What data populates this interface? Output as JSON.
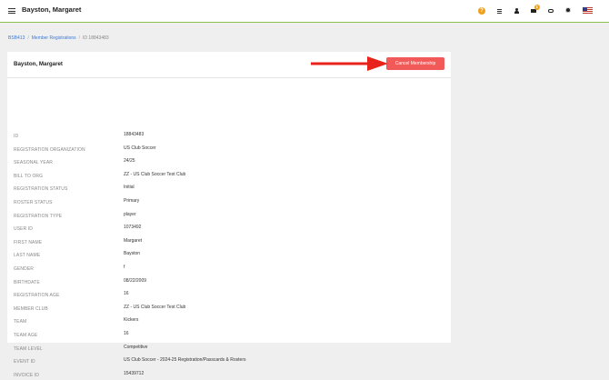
{
  "header": {
    "title": "Bayston, Margaret",
    "help_label": "?",
    "messages_badge": "1",
    "accent_color": "#8bbf4f"
  },
  "icons": [
    "menu-icon",
    "help-icon",
    "list-icon",
    "user-icon",
    "mail-icon",
    "chat-icon",
    "gear-icon",
    "flag-icon"
  ],
  "breadcrumb": {
    "items": [
      "BSB413",
      "Member Registrations",
      "ID 18843483"
    ]
  },
  "card": {
    "title": "Bayston, Margaret",
    "cancel_label": "Cancel Membership",
    "cancel_color": "#f25a5a",
    "arrow_color": "#e8231b"
  },
  "fields": [
    {
      "label": "ID",
      "value": "18843483"
    },
    {
      "label": "Registration Organization",
      "value": "US Club Soccer"
    },
    {
      "label": "Seasonal Year",
      "value": "24/25"
    },
    {
      "label": "Bill to Org",
      "value": "ZZ - US Club Soccer Test Club"
    },
    {
      "label": "Registration Status",
      "value": "Initial"
    },
    {
      "label": "Roster Status",
      "value": "Primary"
    },
    {
      "label": "Registration Type",
      "value": "player"
    },
    {
      "label": "User ID",
      "value": "1073492"
    },
    {
      "label": "First Name",
      "value": "Margaret"
    },
    {
      "label": "Last Name",
      "value": "Bayston"
    },
    {
      "label": "Gender",
      "value": "f"
    },
    {
      "label": "Birthdate",
      "value": "08/22/2009"
    },
    {
      "label": "Registration Age",
      "value": "16"
    },
    {
      "label": "Member Club",
      "value": "ZZ - US Club Soccer Test Club"
    },
    {
      "label": "Team",
      "value": "Kickers"
    },
    {
      "label": "Team Age",
      "value": "16"
    },
    {
      "label": "Team Level",
      "value": "Competitive"
    },
    {
      "label": "Event ID",
      "value": "US Club Soccer - 2024-25 Registration/Passcards & Rosters"
    },
    {
      "label": "Invoice ID",
      "value": "15439712"
    }
  ]
}
